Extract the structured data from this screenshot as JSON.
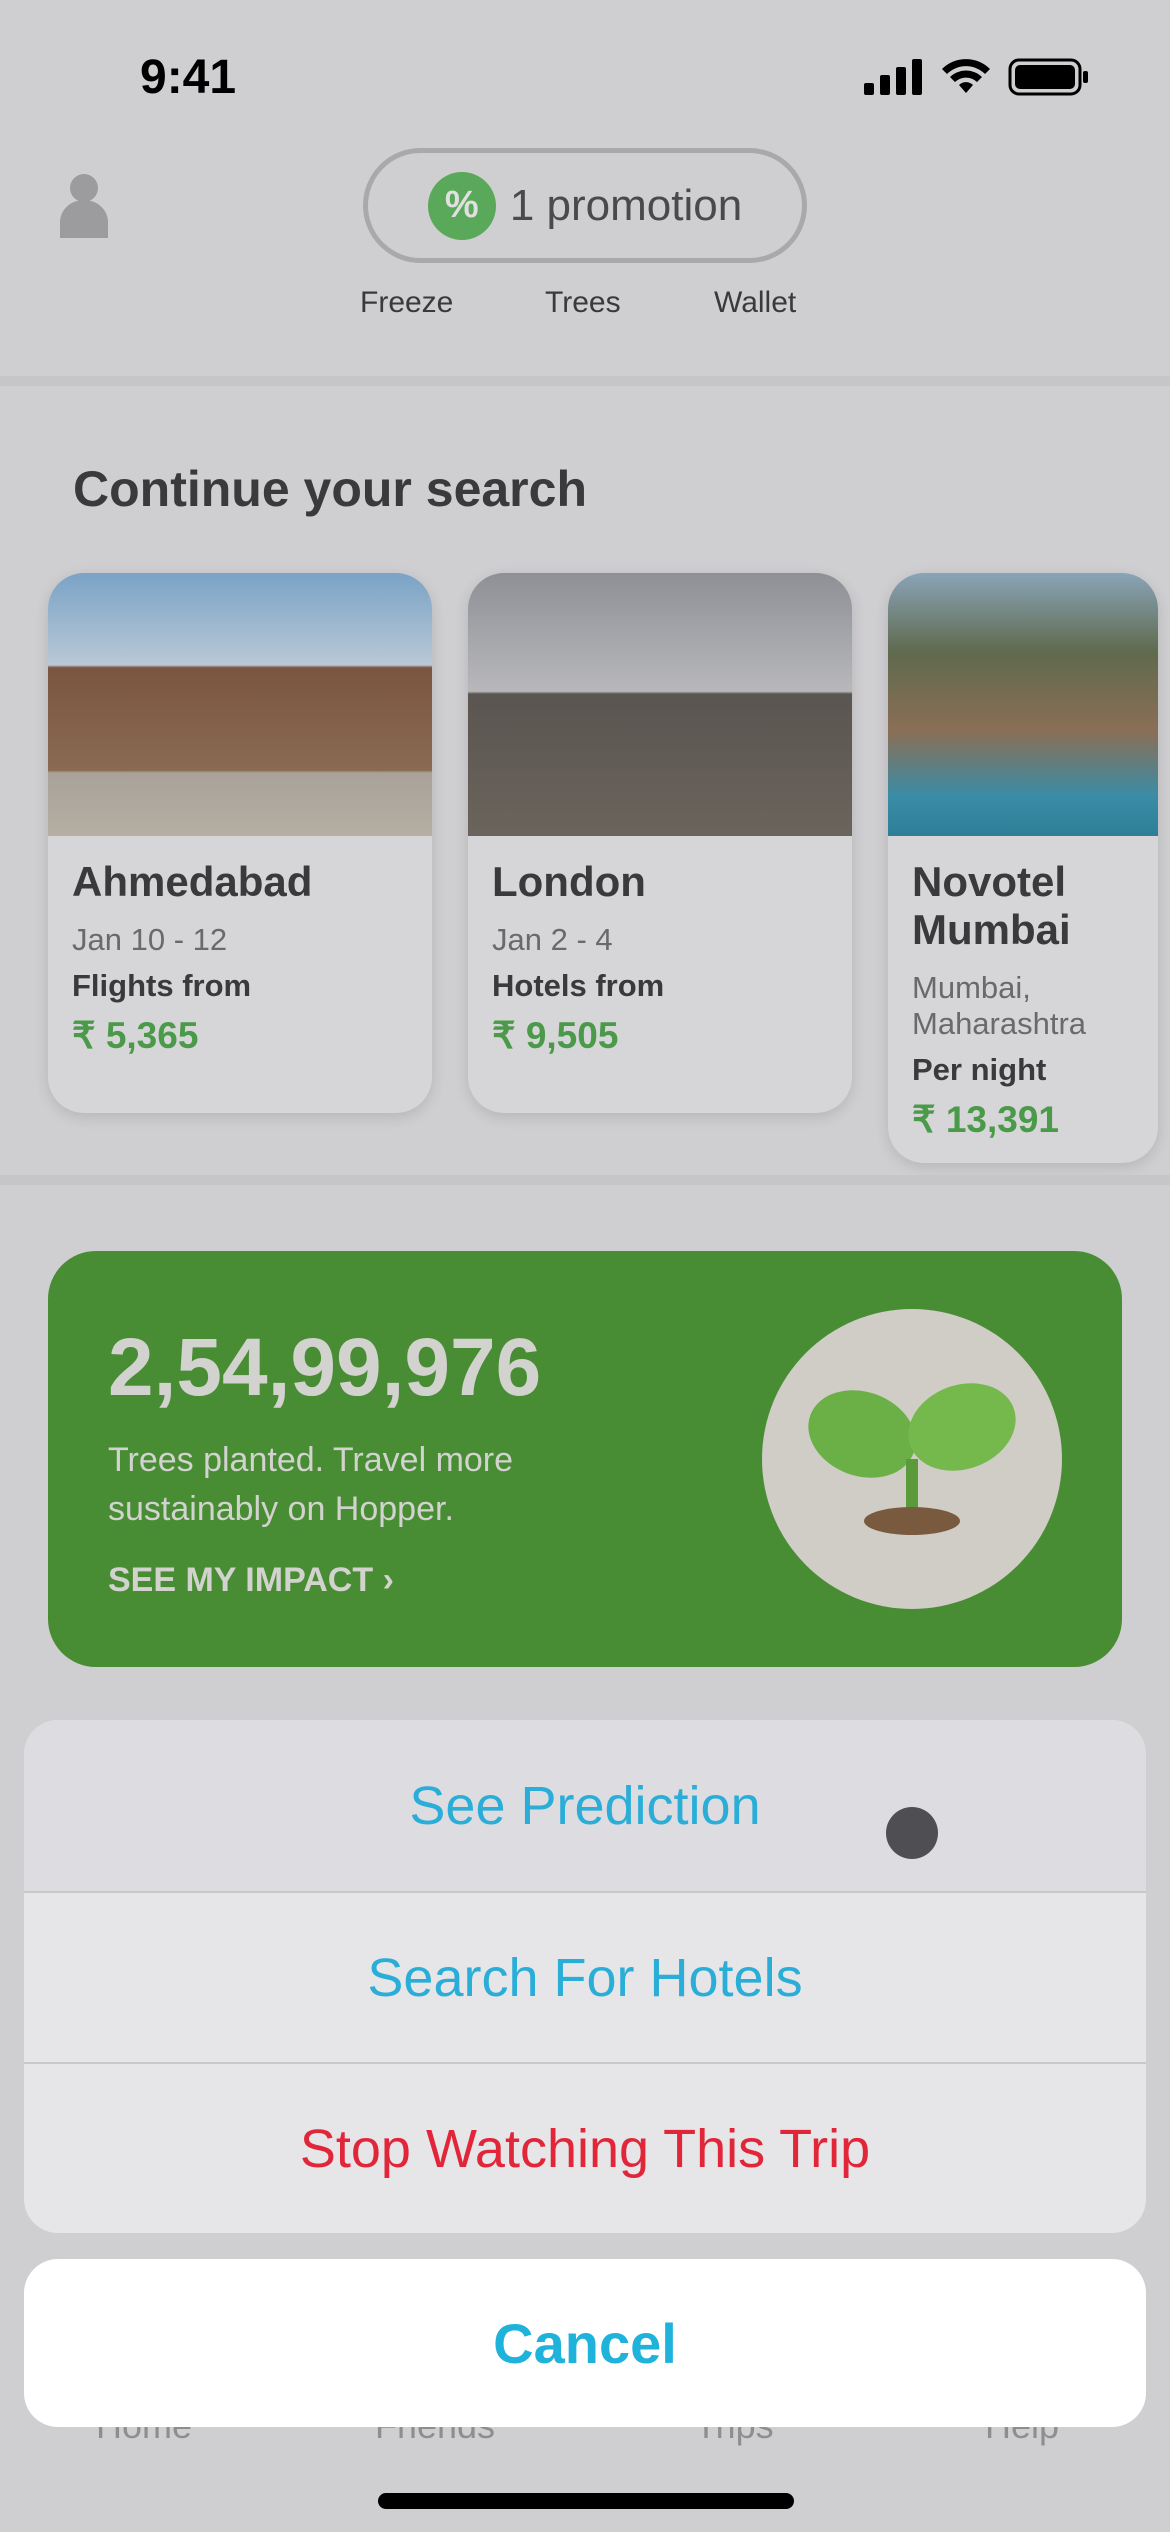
{
  "status": {
    "time": "9:41"
  },
  "header": {
    "promo": "1 promotion",
    "items": [
      "Freeze",
      "Trees",
      "Wallet"
    ]
  },
  "continue": {
    "title": "Continue your search",
    "cards": [
      {
        "title": "Ahmedabad",
        "dates": "Jan 10 -  12",
        "label": "Flights from",
        "price": "₹ 5,365"
      },
      {
        "title": "London",
        "dates": "Jan 2 -  4",
        "label": "Hotels from",
        "price": "₹ 9,505"
      },
      {
        "title": "Novotel Mumbai",
        "dates": "Mumbai, Maharashtra",
        "label": "Per night",
        "price": "₹ 13,391"
      }
    ]
  },
  "trees": {
    "count": "2,54,99,976",
    "text": "Trees planted. Travel more sustainably on Hopper.",
    "link": "SEE MY IMPACT",
    "color": "#488d34"
  },
  "sheet": {
    "actions": [
      "See Prediction",
      "Search For Hotels",
      "Stop Watching This Trip"
    ],
    "cancel": "Cancel"
  },
  "tabs": [
    "Home",
    "Friends",
    "Trips",
    "Help"
  ]
}
